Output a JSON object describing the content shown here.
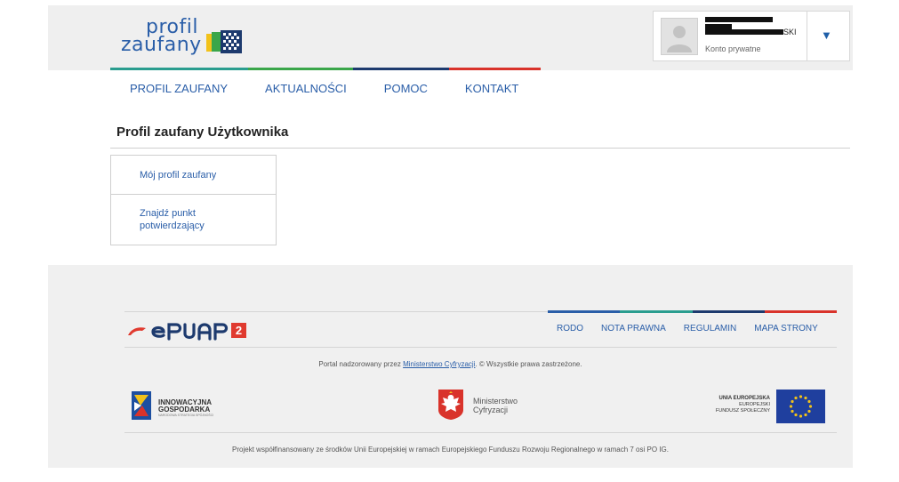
{
  "header": {
    "logo": {
      "line1": "profil",
      "line2": "zaufany"
    },
    "user": {
      "name_suffix": "SKI",
      "account_type": "Konto prywatne"
    },
    "dropdown_icon": "triangle-down-icon"
  },
  "nav": {
    "items": [
      {
        "label": "PROFIL ZAUFANY"
      },
      {
        "label": "AKTUALNOŚCI"
      },
      {
        "label": "POMOC"
      },
      {
        "label": "KONTAKT"
      }
    ]
  },
  "main": {
    "title": "Profil zaufany Użytkownika",
    "menu": [
      {
        "label": "Mój profil zaufany"
      },
      {
        "label": "Znajdź punkt potwierdzający"
      }
    ]
  },
  "footer": {
    "links": [
      {
        "label": "RODO"
      },
      {
        "label": "NOTA PRAWNA"
      },
      {
        "label": "REGULAMIN"
      },
      {
        "label": "MAPA STRONY"
      }
    ],
    "supervised_prefix": "Portal nadzorowany przez ",
    "supervised_link": "Ministerstwo Cyfryzacji",
    "supervised_suffix": ". © Wszystkie prawa zastrzeżone.",
    "partners": {
      "ig": {
        "line1": "INNOWACYJNA",
        "line2": "GOSPODARKA",
        "line3": "NARODOWA STRATEGIA SPÓJNOŚCI"
      },
      "mc": {
        "line1": "Ministerstwo",
        "line2": "Cyfryzacji"
      },
      "eu": {
        "line1": "UNIA EUROPEJSKA",
        "line2": "EUROPEJSKI",
        "line3": "FUNDUSZ SPOŁECZNY"
      }
    },
    "cofinanced": "Projekt współfinansowany ze środków Unii Europejskiej w ramach Europejskiego Funduszu Rozwoju Regionalnego w ramach 7 osi PO IG."
  },
  "colors": {
    "brand_blue": "#2a5ea8",
    "stripe_teal": "#2a9d8f",
    "stripe_green": "#3aa64a",
    "stripe_navy": "#1d3a6e",
    "stripe_red": "#d9332b",
    "epuap_red": "#e03a2f"
  }
}
